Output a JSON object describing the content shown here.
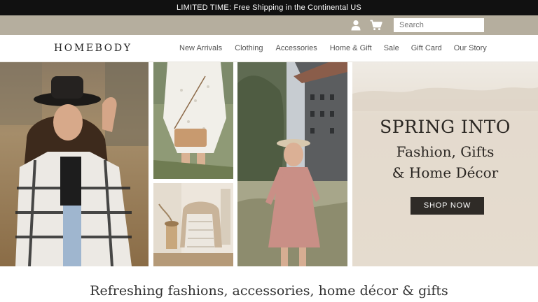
{
  "promo": {
    "text": "LIMITED TIME: Free Shipping in the Continental US"
  },
  "utility": {
    "account_icon": "person-icon",
    "cart_icon": "cart-icon",
    "search_placeholder": "Search"
  },
  "header": {
    "logo": "HOMEBODY",
    "menu": [
      "New Arrivals",
      "Clothing",
      "Accessories",
      "Home & Gift",
      "Sale",
      "Gift Card",
      "Our Story"
    ]
  },
  "hero": {
    "headline_1": "SPRING INTO",
    "headline_2": "Fashion, Gifts",
    "headline_3": "& Home Décor",
    "cta": "SHOP NOW"
  },
  "tagline": "Refreshing fashions, accessories, home décor & gifts",
  "colors": {
    "promo_bar": "#111111",
    "utility_bar": "#b5ae9e",
    "cta_button": "#2f2b27"
  }
}
